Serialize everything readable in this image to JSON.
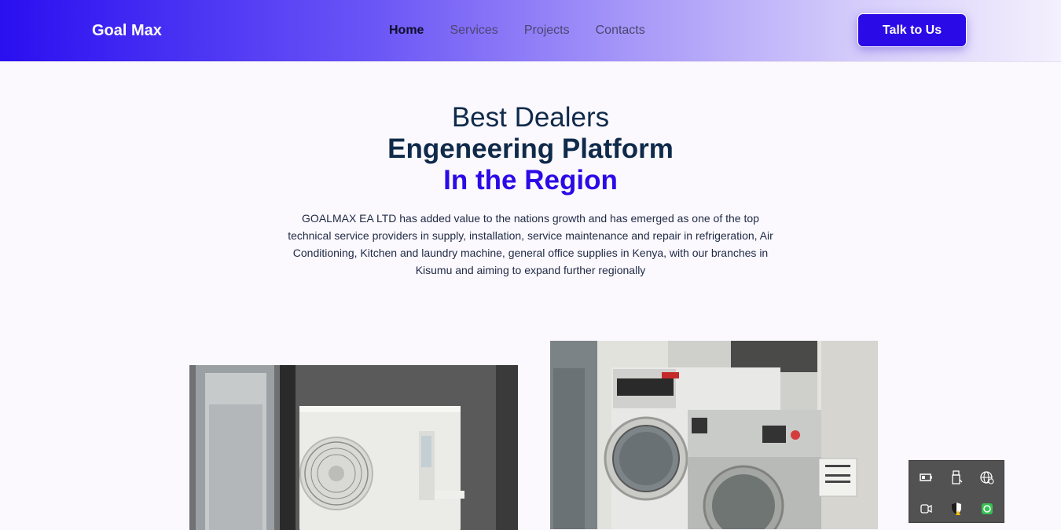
{
  "header": {
    "brand": "Goal Max",
    "nav": [
      {
        "label": "Home",
        "active": true
      },
      {
        "label": "Services",
        "active": false
      },
      {
        "label": "Projects",
        "active": false
      },
      {
        "label": "Contacts",
        "active": false
      }
    ],
    "cta_label": "Talk to Us"
  },
  "hero": {
    "line1": "Best Dealers",
    "line2": "Engeneering Platform",
    "line3": "In the Region",
    "description": "GOALMAX EA LTD has added value to the nations growth and has emerged as one of the top technical service providers in supply, installation, service maintenance and repair in refrigeration, Air Conditioning, Kitchen and laundry machine, general office supplies in Kenya, with our branches in Kisumu and aiming to expand further regionally"
  },
  "images": [
    {
      "name": "air-conditioner-outdoor-unit-photo"
    },
    {
      "name": "laundry-machines-photo"
    }
  ],
  "system_tray": {
    "icons": [
      "battery-icon",
      "usb-drive-icon",
      "network-globe-icon",
      "camera-icon",
      "security-shield-icon",
      "green-app-icon"
    ]
  },
  "colors": {
    "accent": "#2a0ae6",
    "heading": "#0f2a4a",
    "background": "#fbf8fe"
  }
}
